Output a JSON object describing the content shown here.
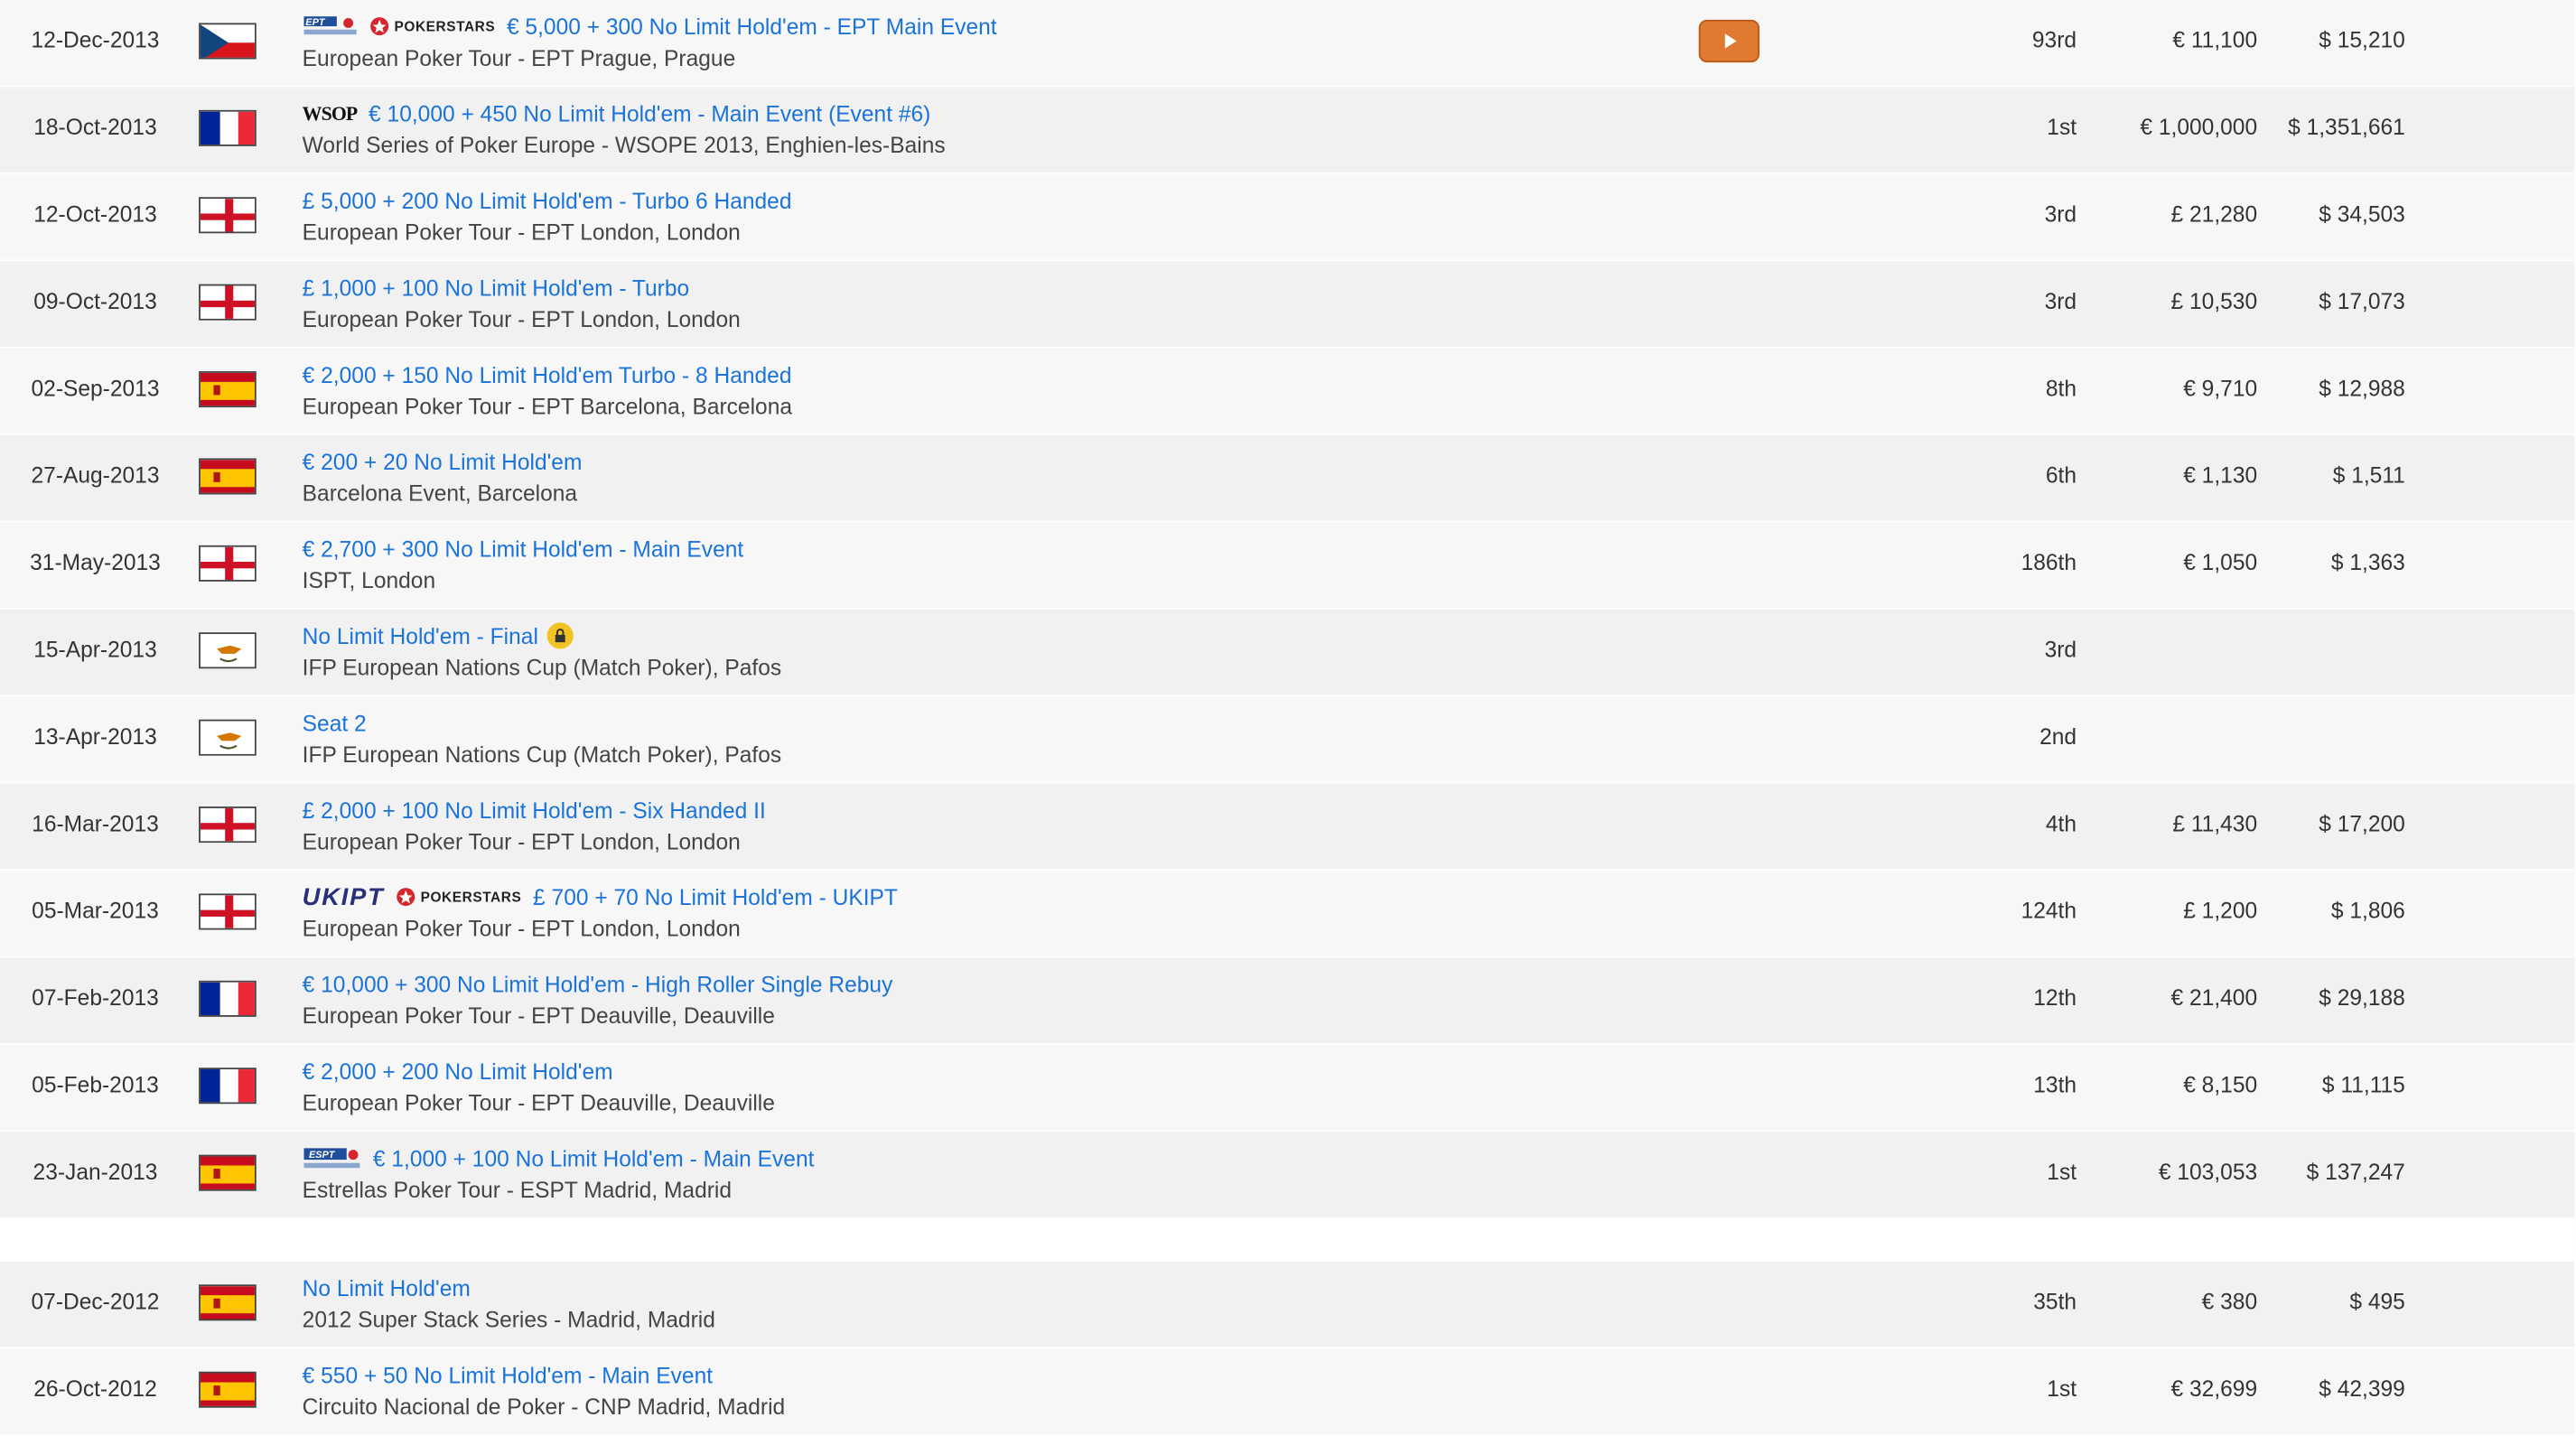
{
  "brand": {
    "link": "#1a73d9",
    "video": "#e07a30",
    "lock": "#f3c325"
  },
  "logos": {
    "pokerstars": "POKERSTARS",
    "wsop": "WSOP",
    "ukipt": "UKIPT"
  },
  "results": [
    {
      "date": "12-Dec-2013",
      "flag": "czech-republic",
      "logos": [
        "ept-logo",
        "pokerstars-logo"
      ],
      "event": "€ 5,000 + 300 No Limit Hold'em - EPT Main Event",
      "series": "European Poker Tour - EPT Prague, Prague",
      "place": "93rd",
      "prize": "€ 11,100",
      "usd": "$ 15,210",
      "video": true
    },
    {
      "date": "18-Oct-2013",
      "flag": "france",
      "logos": [
        "wsop-logo"
      ],
      "event": "€ 10,000 + 450 No Limit Hold'em - Main Event (Event #6)",
      "series": "World Series of Poker Europe - WSOPE 2013, Enghien-les-Bains",
      "place": "1st",
      "prize": "€ 1,000,000",
      "usd": "$ 1,351,661"
    },
    {
      "date": "12-Oct-2013",
      "flag": "england",
      "logos": [],
      "event": "£ 5,000 + 200 No Limit Hold'em - Turbo 6 Handed",
      "series": "European Poker Tour - EPT London, London",
      "place": "3rd",
      "prize": "£ 21,280",
      "usd": "$ 34,503"
    },
    {
      "date": "09-Oct-2013",
      "flag": "england",
      "logos": [],
      "event": "£ 1,000 + 100 No Limit Hold'em - Turbo",
      "series": "European Poker Tour - EPT London, London",
      "place": "3rd",
      "prize": "£ 10,530",
      "usd": "$ 17,073"
    },
    {
      "date": "02-Sep-2013",
      "flag": "spain",
      "logos": [],
      "event": "€ 2,000 + 150 No Limit Hold'em Turbo - 8 Handed",
      "series": "European Poker Tour - EPT Barcelona, Barcelona",
      "place": "8th",
      "prize": "€ 9,710",
      "usd": "$ 12,988"
    },
    {
      "date": "27-Aug-2013",
      "flag": "spain",
      "logos": [],
      "event": "€ 200 + 20 No Limit Hold'em",
      "series": "Barcelona Event, Barcelona",
      "place": "6th",
      "prize": "€ 1,130",
      "usd": "$ 1,511"
    },
    {
      "date": "31-May-2013",
      "flag": "england",
      "logos": [],
      "event": "€ 2,700 + 300 No Limit Hold'em - Main Event",
      "series": "ISPT, London",
      "place": "186th",
      "prize": "€ 1,050",
      "usd": "$ 1,363"
    },
    {
      "date": "15-Apr-2013",
      "flag": "cyprus",
      "logos": [],
      "event": "No Limit Hold'em - Final",
      "series": "IFP European Nations Cup (Match Poker), Pafos",
      "place": "3rd",
      "prize": "",
      "usd": "",
      "lock": true
    },
    {
      "date": "13-Apr-2013",
      "flag": "cyprus",
      "logos": [],
      "event": "Seat 2",
      "series": "IFP European Nations Cup (Match Poker), Pafos",
      "place": "2nd",
      "prize": "",
      "usd": ""
    },
    {
      "date": "16-Mar-2013",
      "flag": "england",
      "logos": [],
      "event": "£ 2,000 + 100 No Limit Hold'em - Six Handed II",
      "series": "European Poker Tour - EPT London, London",
      "place": "4th",
      "prize": "£ 11,430",
      "usd": "$ 17,200"
    },
    {
      "date": "05-Mar-2013",
      "flag": "england",
      "logos": [
        "ukipt-logo",
        "pokerstars-logo"
      ],
      "event": "£ 700 + 70 No Limit Hold'em - UKIPT",
      "series": "European Poker Tour - EPT London, London",
      "place": "124th",
      "prize": "£ 1,200",
      "usd": "$ 1,806"
    },
    {
      "date": "07-Feb-2013",
      "flag": "france",
      "logos": [],
      "event": "€ 10,000 + 300 No Limit Hold'em - High Roller Single Rebuy",
      "series": "European Poker Tour - EPT Deauville, Deauville",
      "place": "12th",
      "prize": "€ 21,400",
      "usd": "$ 29,188"
    },
    {
      "date": "05-Feb-2013",
      "flag": "france",
      "logos": [],
      "event": "€ 2,000 + 200 No Limit Hold'em",
      "series": "European Poker Tour - EPT Deauville, Deauville",
      "place": "13th",
      "prize": "€ 8,150",
      "usd": "$ 11,115"
    },
    {
      "date": "23-Jan-2013",
      "flag": "spain",
      "logos": [
        "espt-logo"
      ],
      "event": "€ 1,000 + 100 No Limit Hold'em - Main Event",
      "series": "Estrellas Poker Tour - ESPT Madrid, Madrid",
      "place": "1st",
      "prize": "€ 103,053",
      "usd": "$ 137,247"
    },
    {
      "date": "07-Dec-2012",
      "flag": "spain",
      "logos": [],
      "event": "No Limit Hold'em",
      "series": "2012 Super Stack Series - Madrid, Madrid",
      "place": "35th",
      "prize": "€ 380",
      "usd": "$ 495"
    },
    {
      "date": "26-Oct-2012",
      "flag": "spain",
      "logos": [],
      "event": "€ 550 + 50 No Limit Hold'em - Main Event",
      "series": "Circuito Nacional de Poker - CNP Madrid, Madrid",
      "place": "1st",
      "prize": "€ 32,699",
      "usd": "$ 42,399"
    }
  ]
}
